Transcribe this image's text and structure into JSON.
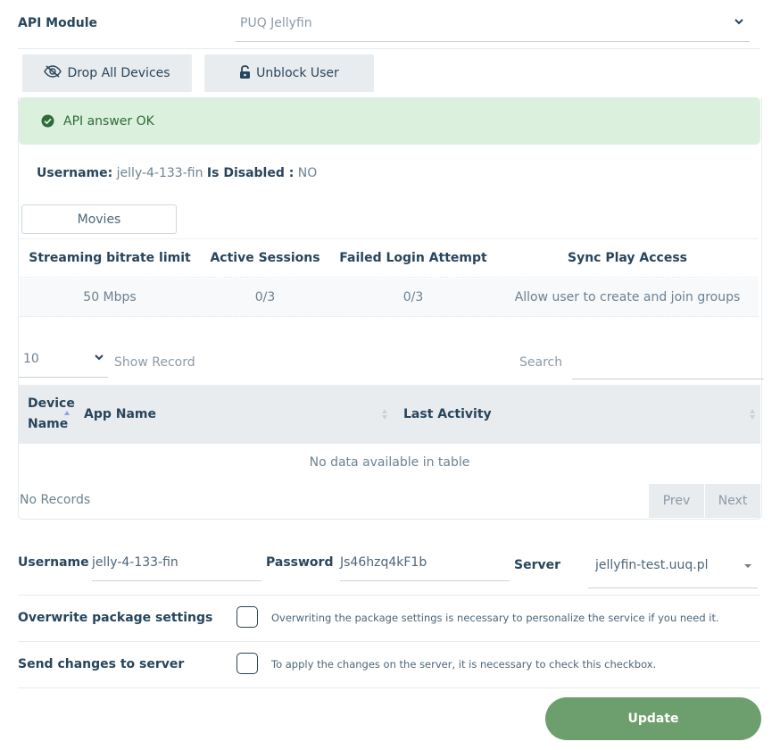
{
  "api_module": {
    "label": "API Module",
    "selected": "PUQ Jellyfin",
    "icon": "chevron-down-icon"
  },
  "actions": {
    "drop_devices_label": "Drop All Devices",
    "drop_devices_icon": "eye-slash-icon",
    "unblock_user_label": "Unblock User",
    "unblock_user_icon": "unlock-icon"
  },
  "alert": {
    "text": "API answer OK",
    "icon": "check-circle-icon",
    "color": "#dcf1dd"
  },
  "user_info": {
    "username_label": "Username:",
    "username_value": "jelly-4-133-fin",
    "disabled_label": "Is Disabled :",
    "disabled_value": "NO"
  },
  "tabs": [
    {
      "label": "Movies"
    }
  ],
  "stats": {
    "headers": [
      "Streaming bitrate limit",
      "Active Sessions",
      "Failed Login Attempt",
      "Sync Play Access"
    ],
    "values": [
      "50 Mbps",
      "0/3",
      "0/3",
      "Allow user to create and join groups"
    ]
  },
  "table_controls": {
    "length_value": "10",
    "show_record_label": "Show Record",
    "search_label": "Search",
    "search_value": ""
  },
  "devices_table": {
    "columns": [
      "Device Name",
      "App Name",
      "Last Activity"
    ],
    "device_col_line1": "Device",
    "device_col_line2": "Name",
    "empty_text": "No data available in table",
    "records_text": "No Records",
    "prev_label": "Prev",
    "next_label": "Next"
  },
  "form": {
    "username_label": "Username",
    "username_value": "jelly-4-133-fin",
    "password_label": "Password",
    "password_value": "Js46hzq4kF1b",
    "server_label": "Server",
    "server_value": "jellyfin-test.uuq.pl",
    "overwrite_label": "Overwrite package settings",
    "overwrite_checked": false,
    "overwrite_help": "Overwriting the package settings is necessary to personalize the service if you need it.",
    "send_label": "Send changes to server",
    "send_checked": false,
    "send_help": "To apply the changes on the server, it is necessary to check this checkbox.",
    "update_label": "Update",
    "update_color": "#6d9f6e"
  }
}
